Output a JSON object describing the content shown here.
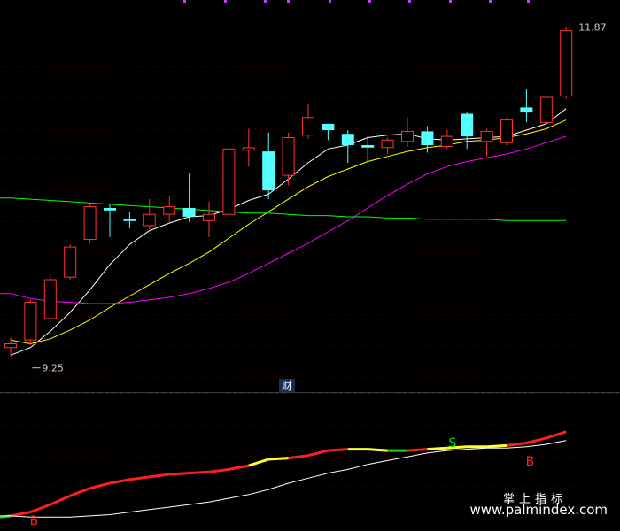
{
  "chart_data": [
    {
      "type": "candlestick",
      "panel": "main",
      "price_range": [
        9.1,
        12.0
      ],
      "candles": [
        {
          "o": 9.35,
          "h": 9.4,
          "l": 9.25,
          "c": 9.32,
          "color": "red"
        },
        {
          "o": 9.38,
          "h": 9.7,
          "l": 9.34,
          "c": 9.68,
          "color": "red"
        },
        {
          "o": 9.55,
          "h": 9.9,
          "l": 9.53,
          "c": 9.86,
          "color": "red"
        },
        {
          "o": 9.88,
          "h": 10.14,
          "l": 9.86,
          "c": 10.12,
          "color": "red"
        },
        {
          "o": 10.18,
          "h": 10.47,
          "l": 10.15,
          "c": 10.44,
          "color": "red"
        },
        {
          "o": 10.43,
          "h": 10.46,
          "l": 10.2,
          "c": 10.41,
          "color": "cyan"
        },
        {
          "o": 10.34,
          "h": 10.4,
          "l": 10.27,
          "c": 10.33,
          "color": "cyan"
        },
        {
          "o": 10.29,
          "h": 10.5,
          "l": 10.26,
          "c": 10.38,
          "color": "red"
        },
        {
          "o": 10.38,
          "h": 10.52,
          "l": 10.31,
          "c": 10.44,
          "color": "red"
        },
        {
          "o": 10.43,
          "h": 10.71,
          "l": 10.32,
          "c": 10.36,
          "color": "cyan"
        },
        {
          "o": 10.33,
          "h": 10.48,
          "l": 10.2,
          "c": 10.38,
          "color": "red"
        },
        {
          "o": 10.38,
          "h": 10.92,
          "l": 10.36,
          "c": 10.9,
          "color": "red"
        },
        {
          "o": 10.89,
          "h": 11.06,
          "l": 10.76,
          "c": 10.91,
          "color": "red"
        },
        {
          "o": 10.88,
          "h": 11.03,
          "l": 10.5,
          "c": 10.57,
          "color": "cyan"
        },
        {
          "o": 10.69,
          "h": 11.03,
          "l": 10.61,
          "c": 10.99,
          "color": "red"
        },
        {
          "o": 11.01,
          "h": 11.26,
          "l": 10.98,
          "c": 11.15,
          "color": "red"
        },
        {
          "o": 11.1,
          "h": 11.09,
          "l": 10.97,
          "c": 11.05,
          "color": "cyan"
        },
        {
          "o": 11.02,
          "h": 11.05,
          "l": 10.79,
          "c": 10.93,
          "color": "cyan"
        },
        {
          "o": 10.93,
          "h": 11.0,
          "l": 10.8,
          "c": 10.91,
          "color": "cyan"
        },
        {
          "o": 10.91,
          "h": 10.99,
          "l": 10.86,
          "c": 10.97,
          "color": "red"
        },
        {
          "o": 10.96,
          "h": 11.15,
          "l": 10.92,
          "c": 11.04,
          "color": "red"
        },
        {
          "o": 11.04,
          "h": 11.08,
          "l": 10.87,
          "c": 10.93,
          "color": "cyan"
        },
        {
          "o": 10.92,
          "h": 11.05,
          "l": 10.9,
          "c": 11.0,
          "color": "red"
        },
        {
          "o": 11.0,
          "h": 11.19,
          "l": 10.9,
          "c": 11.18,
          "color": "cyan"
        },
        {
          "o": 11.04,
          "h": 11.06,
          "l": 10.84,
          "c": 10.96,
          "color": "red"
        },
        {
          "o": 10.95,
          "h": 11.15,
          "l": 10.93,
          "c": 11.13,
          "color": "red"
        },
        {
          "o": 11.23,
          "h": 11.38,
          "l": 11.11,
          "c": 11.19,
          "color": "cyan"
        },
        {
          "o": 11.11,
          "h": 11.33,
          "l": 11.1,
          "c": 11.31,
          "color": "red"
        },
        {
          "o": 11.32,
          "h": 11.87,
          "l": 11.3,
          "c": 11.84,
          "color": "red"
        }
      ],
      "ma": [
        {
          "color": "#ffffff",
          "values": [
            9.26,
            9.32,
            9.45,
            9.6,
            9.78,
            9.98,
            10.14,
            10.25,
            10.31,
            10.36,
            10.37,
            10.42,
            10.49,
            10.54,
            10.66,
            10.79,
            10.9,
            10.93,
            10.99,
            11.01,
            11.02,
            10.98,
            10.97,
            10.98,
            10.99,
            11.0,
            11.05,
            11.1,
            11.22
          ]
        },
        {
          "color": "#ffff00",
          "values": [
            9.38,
            9.35,
            9.39,
            9.46,
            9.54,
            9.64,
            9.73,
            9.82,
            9.91,
            9.99,
            10.08,
            10.19,
            10.3,
            10.4,
            10.5,
            10.6,
            10.68,
            10.74,
            10.8,
            10.84,
            10.88,
            10.91,
            10.93,
            10.96,
            10.97,
            10.99,
            11.02,
            11.06,
            11.13
          ]
        },
        {
          "color": "#ff00ff",
          "values": [
            9.75,
            9.71,
            9.69,
            9.68,
            9.67,
            9.67,
            9.68,
            9.7,
            9.72,
            9.75,
            9.79,
            9.84,
            9.91,
            9.99,
            10.07,
            10.15,
            10.24,
            10.33,
            10.43,
            10.53,
            10.62,
            10.7,
            10.76,
            10.8,
            10.83,
            10.86,
            10.9,
            10.95,
            11.0
          ]
        },
        {
          "color": "#00ff00",
          "values": [
            10.51,
            10.5,
            10.49,
            10.48,
            10.47,
            10.46,
            10.45,
            10.44,
            10.43,
            10.42,
            10.41,
            10.4,
            10.39,
            10.39,
            10.38,
            10.37,
            10.37,
            10.36,
            10.36,
            10.35,
            10.35,
            10.34,
            10.34,
            10.34,
            10.34,
            10.33,
            10.33,
            10.33,
            10.33
          ]
        }
      ],
      "annotations": [
        {
          "text": "11.87",
          "kind": "high_marker",
          "value": 11.87,
          "index": 28
        },
        {
          "text": "9.25",
          "kind": "low_marker",
          "value": 9.25,
          "index": 1
        }
      ],
      "label": "财"
    },
    {
      "type": "line",
      "panel": "indicator",
      "y_range": [
        0,
        100
      ],
      "series": [
        {
          "values": [
            4,
            5,
            8,
            14,
            21,
            27,
            31,
            34,
            36,
            38,
            39,
            40,
            42,
            45,
            50,
            51,
            53,
            57,
            58,
            58,
            57,
            57,
            58,
            59,
            60,
            60,
            61,
            63,
            67,
            72
          ],
          "segment_colors": [
            "green",
            "red",
            "red",
            "red",
            "red",
            "red",
            "red",
            "red",
            "red",
            "red",
            "red",
            "red",
            "red",
            "yellow",
            "yellow",
            "red",
            "red",
            "red",
            "yellow",
            "yellow",
            "green",
            "red",
            "yellow",
            "yellow",
            "yellow",
            "yellow",
            "red",
            "red",
            "red"
          ]
        },
        {
          "values": [
            5,
            5,
            4,
            4,
            4,
            5,
            6,
            8,
            10,
            12,
            14,
            16,
            19,
            22,
            26,
            31,
            35,
            39,
            42,
            46,
            49,
            52,
            55,
            57,
            58,
            59,
            59,
            60,
            62,
            65
          ],
          "color": "#ffffff"
        }
      ],
      "signals": [
        {
          "text": "B",
          "index": 2,
          "color": "#ff2020"
        },
        {
          "text": "S",
          "index": 23,
          "color": "#00e000"
        },
        {
          "text": "B",
          "index": 27,
          "color": "#ff2020"
        }
      ]
    }
  ],
  "watermark": {
    "title": "掌上指标",
    "url": "www.palmindex.com"
  }
}
